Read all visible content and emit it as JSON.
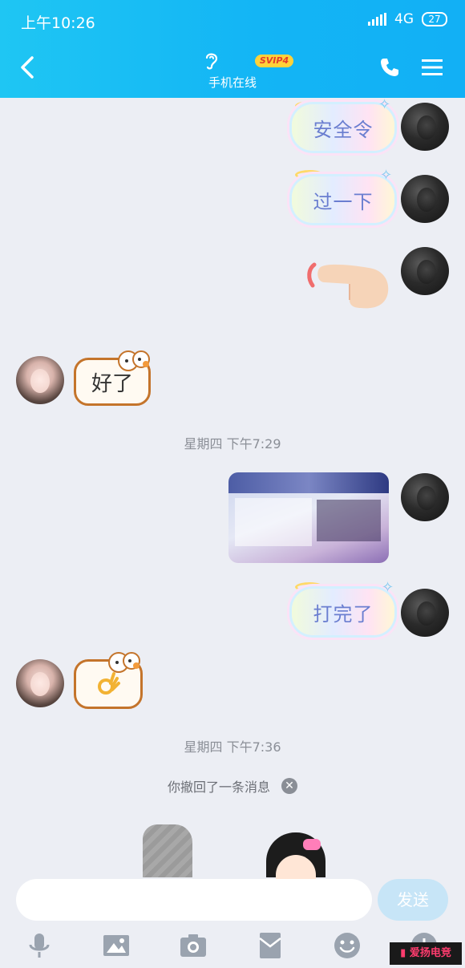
{
  "status_bar": {
    "time": "上午10:26",
    "network": "4G",
    "battery": "27"
  },
  "header": {
    "contact_status": "手机在线",
    "badge": "SVIP4",
    "icons": [
      "back-icon",
      "ear-icon",
      "phone-icon",
      "menu-icon"
    ]
  },
  "messages": {
    "m1": "安全令",
    "m2": "过一下",
    "m3": "好了",
    "m4": "打完了"
  },
  "timestamps": {
    "t1": "星期四 下午7:29",
    "t2": "星期四 下午7:36"
  },
  "recall": {
    "text": "你撤回了一条消息"
  },
  "input": {
    "send_label": "发送"
  },
  "toolbar": [
    "microphone-icon",
    "image-icon",
    "camera-icon",
    "red-packet-icon",
    "emoji-icon",
    "plus-icon"
  ],
  "colors": {
    "header": "#13b5f5",
    "background": "#eceef4",
    "send_button": "#c7e5f7"
  },
  "watermark": "爱扬电竞"
}
